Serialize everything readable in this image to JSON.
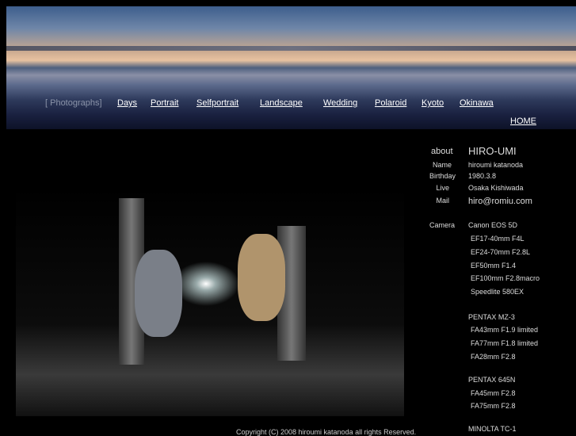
{
  "nav": {
    "items": [
      "[ Photographs]",
      "Days",
      "Portrait",
      "Selfportrait",
      "Landscape",
      "Wedding",
      "Polaroid",
      "Kyoto",
      "Okinawa"
    ],
    "home": "HOME"
  },
  "about": {
    "heading": "about",
    "name_title": "HIRO-UMI",
    "fields": [
      {
        "label": "Name",
        "value": "hiroumi katanoda"
      },
      {
        "label": "Birthday",
        "value": "1980.3.8"
      },
      {
        "label": "Live",
        "value": "Osaka Kishiwada"
      },
      {
        "label": "Mail",
        "value": "hiro@romiu.com"
      }
    ],
    "camera_label": "Camera",
    "equipment": [
      "Canon EOS 5D",
      "EF17-40mm F4L",
      "EF24-70mm F2.8L",
      "EF50mm F1.4",
      "EF100mm F2.8macro",
      "Speedlite 580EX",
      "PENTAX MZ-3",
      "FA43mm F1.9 limited",
      "FA77mm F1.8 limited",
      "FA28mm F2.8",
      "PENTAX 645N",
      "FA45mm F2.8",
      "FA75mm F2.8",
      "MINOLTA TC-1"
    ]
  },
  "footer": {
    "copyright": "Copyright (C) 2008 hiroumi katanoda all rights Reserved."
  }
}
